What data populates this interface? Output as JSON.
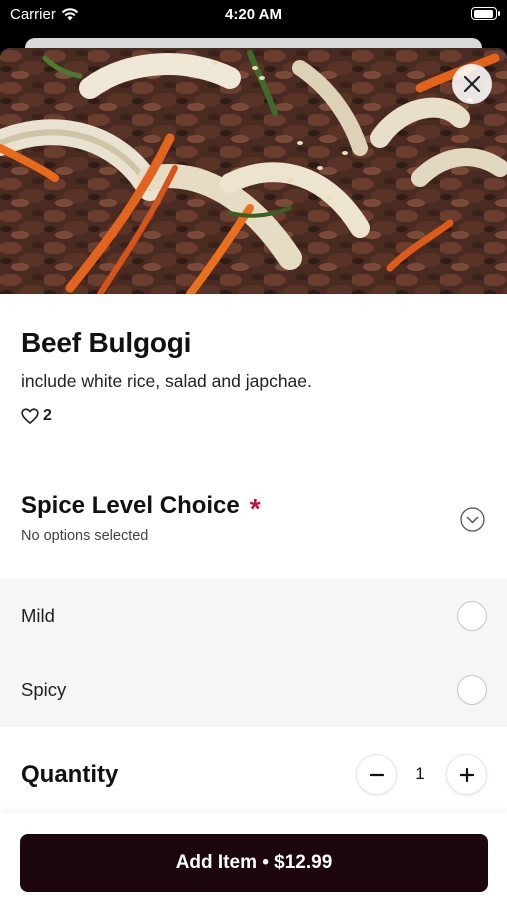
{
  "status_bar": {
    "carrier": "Carrier",
    "time": "4:20 AM",
    "battery_level": 0.95
  },
  "item": {
    "title": "Beef Bulgogi",
    "description": "include white rice, salad and japchae.",
    "likes": "2"
  },
  "option_group": {
    "title": "Spice Level Choice",
    "required_mark": "*",
    "subtitle": "No options selected",
    "options": [
      {
        "label": "Mild",
        "selected": false
      },
      {
        "label": "Spicy",
        "selected": false
      }
    ]
  },
  "quantity": {
    "label": "Quantity",
    "value": "1",
    "minus": "−",
    "plus": "+"
  },
  "footer": {
    "add_button_label": "Add Item • $12.99"
  },
  "icons": {
    "close": "close-icon",
    "heart": "heart-icon",
    "chevron": "chevron-down-circle-icon",
    "wifi": "wifi-icon",
    "battery": "battery-icon"
  },
  "colors": {
    "accent_required": "#c4123f",
    "primary_button": "#1c0711"
  }
}
